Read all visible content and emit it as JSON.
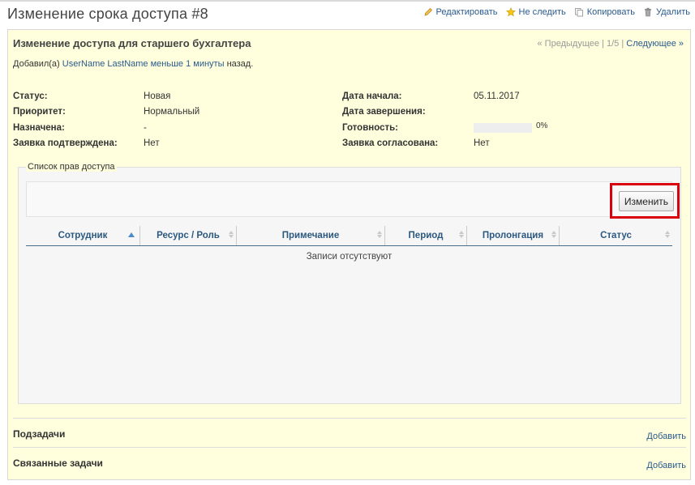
{
  "page": {
    "title": "Изменение срока доступа #8"
  },
  "toolbar": {
    "edit": "Редактировать",
    "unwatch": "Не следить",
    "copy": "Копировать",
    "delete": "Удалить"
  },
  "issue": {
    "subject": "Изменение доступа для старшего бухгалтера",
    "pager": {
      "prev": "« Предыдущее",
      "sep1": "|",
      "position": "1/5",
      "sep2": "|",
      "next": "Следующее »"
    },
    "author": {
      "prefix": "Добавил(а)",
      "user": "UserName LastName",
      "time": "меньше 1 минуты",
      "suffix": "назад."
    },
    "attributes": {
      "status": {
        "label": "Статус:",
        "value": "Новая"
      },
      "priority": {
        "label": "Приоритет:",
        "value": "Нормальный"
      },
      "assignee": {
        "label": "Назначена:",
        "value": "-"
      },
      "confirmed": {
        "label": "Заявка подтверждена:",
        "value": "Нет"
      },
      "start_date": {
        "label": "Дата начала:",
        "value": "05.11.2017"
      },
      "due_date": {
        "label": "Дата завершения:",
        "value": ""
      },
      "done": {
        "label": "Готовность:",
        "value": "0%",
        "progress": 0
      },
      "approved": {
        "label": "Заявка согласована:",
        "value": "Нет"
      }
    }
  },
  "access_rights": {
    "legend": "Список прав доступа",
    "change_button": "Изменить",
    "columns": [
      "Сотрудник",
      "Ресурс / Роль",
      "Примечание",
      "Период",
      "Пролонгация",
      "Статус"
    ],
    "empty_message": "Записи отсутствуют"
  },
  "sections": {
    "subtasks": {
      "title": "Подзадачи",
      "add": "Добавить"
    },
    "related": {
      "title": "Связанные задачи",
      "add": "Добавить"
    }
  },
  "colors": {
    "issue_background": "#ffffdd",
    "link": "#2a5a8c",
    "highlight": "#d9000d"
  }
}
